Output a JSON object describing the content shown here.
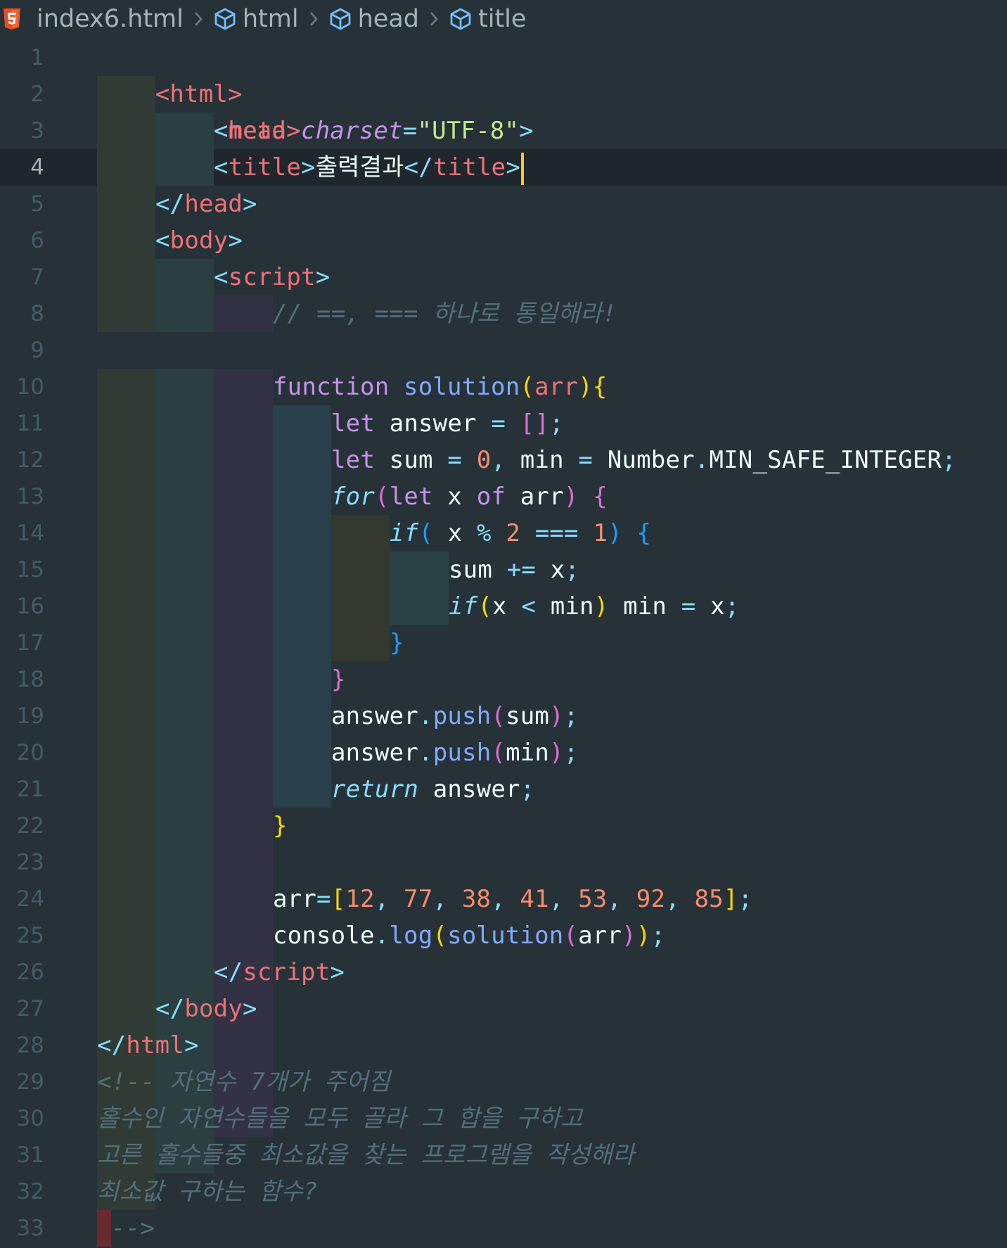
{
  "breadcrumb": {
    "file": "index6.html",
    "items": [
      "html",
      "head",
      "title"
    ],
    "separator": ">"
  },
  "editor": {
    "active_line": 4,
    "line_numbers": [
      "1",
      "2",
      "3",
      "4",
      "5",
      "6",
      "7",
      "8",
      "9",
      "10",
      "11",
      "12",
      "13",
      "14",
      "15",
      "16",
      "17",
      "18",
      "19",
      "20",
      "21",
      "22",
      "23",
      "24",
      "25",
      "26",
      "27",
      "28",
      "29",
      "30",
      "31",
      "32",
      "33"
    ],
    "code": {
      "l1": "<html>",
      "l2": "<head>",
      "l3_meta": "meta",
      "l3_attr": "charset",
      "l3_val": "\"UTF-8\"",
      "l4_title_open": "title",
      "l4_text": "출력결과",
      "l4_title_close": "title",
      "l5": "head",
      "l6": "body",
      "l7": "script",
      "l8_comment": "// ==, === 하나로 통일해라!",
      "l10_kw": "function",
      "l10_fn": "solution",
      "l10_param": "arr",
      "l11_kw": "let",
      "l11_var": "answer",
      "l12_kw": "let",
      "l12_var": "sum",
      "l12_num": "0",
      "l12_var2": "min",
      "l12_obj": "Number",
      "l12_prop": "MIN_SAFE_INTEGER",
      "l13_kw": "for",
      "l13_let": "let",
      "l13_x": "x",
      "l13_of": "of",
      "l13_arr": "arr",
      "l14_kw": "if",
      "l14_x": "x",
      "l14_n2": "2",
      "l14_n1": "1",
      "l15_var": "sum",
      "l15_x": "x",
      "l16_kw": "if",
      "l16_x": "x",
      "l16_min": "min",
      "l16_min2": "min",
      "l16_x2": "x",
      "l19_obj": "answer",
      "l19_fn": "push",
      "l19_arg": "sum",
      "l20_obj": "answer",
      "l20_fn": "push",
      "l20_arg": "min",
      "l21_kw": "return",
      "l21_var": "answer",
      "l24_var": "arr",
      "l24_values": [
        "12",
        "77",
        "38",
        "41",
        "53",
        "92",
        "85"
      ],
      "l25_obj": "console",
      "l25_fn": "log",
      "l25_fn2": "solution",
      "l25_arg": "arr",
      "l26": "script",
      "l27": "body",
      "l28": "html",
      "l29": "<!-- 자연수 7개가 주어짐",
      "l30": "홀수인 자연수들을 모두 골라 그 합을 구하고",
      "l31": "고른 홀수들중 최소값을 찾는 프로그램을 작성해라",
      "l32": "최소값 구하는 함수?",
      "l33": "-->"
    }
  },
  "colors": {
    "background": "#263238",
    "tag": "#f07178",
    "punctuation": "#89ddff",
    "keyword": "#c792ea",
    "function": "#82aaff",
    "number": "#f78c6c",
    "string": "#c3e88d",
    "comment": "#546e7a",
    "cursor": "#ffcc00"
  }
}
